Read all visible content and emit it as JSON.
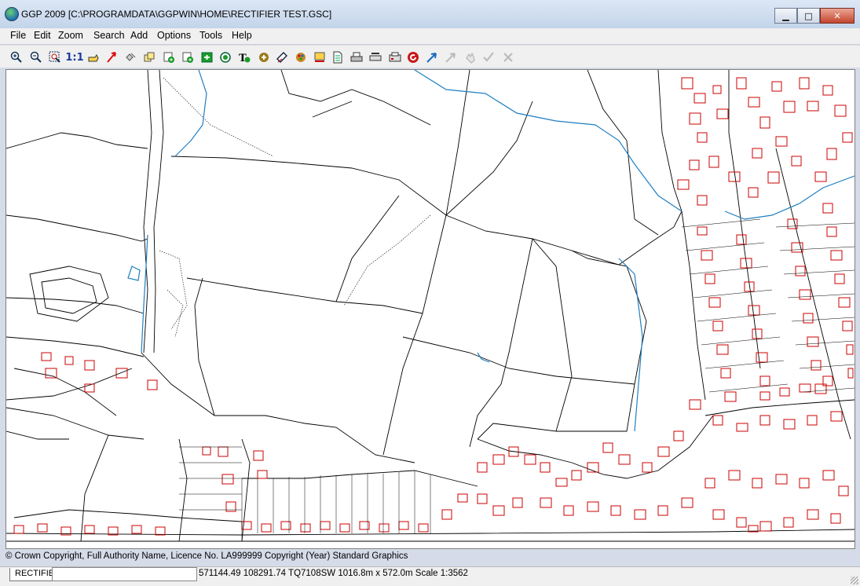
{
  "window": {
    "title": "GGP 2009 [C:\\PROGRAMDATA\\GGPWIN\\HOME\\RECTIFIER TEST.GSC]",
    "minimize_glyph": "▁",
    "maximize_glyph": "□",
    "close_glyph": "✕"
  },
  "menu": [
    "File",
    "Edit",
    "Zoom",
    "Search",
    "Add",
    "Options",
    "Tools",
    "Help"
  ],
  "toolbar": {
    "zoom_in_icon": "zoom-in-icon",
    "zoom_out_icon": "zoom-out-icon",
    "zoom_window_icon": "zoom-window-icon",
    "scale_label": "1:1",
    "disabled_icons": [
      "tick-icon",
      "cross-icon"
    ]
  },
  "map": {
    "feature_color": "#000000",
    "building_color": "#cc0000",
    "water_color": "#1f7fc2"
  },
  "footer": {
    "copyright": "© Crown Copyright, Full Authority Name, Licence No. LA999999 Copyright (Year) Standard Graphics",
    "tab_label": "RECTIFIE",
    "status": "571144.49 108291.74 TQ7108SW 1016.8m x 572.0m Scale 1:3562"
  }
}
